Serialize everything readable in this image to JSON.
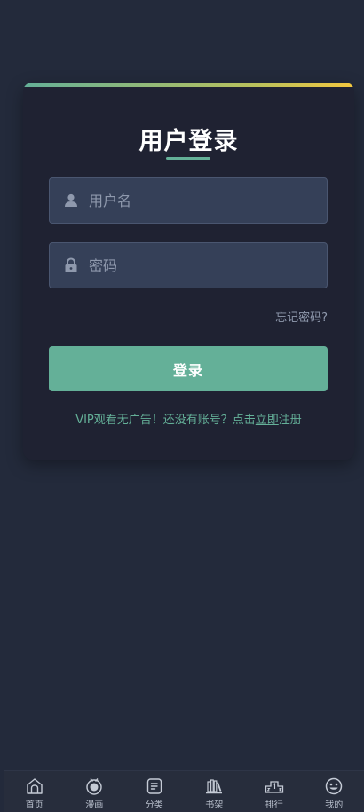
{
  "login_card": {
    "title": "用户登录",
    "username_placeholder": "用户名",
    "username_icon": "user-icon",
    "password_placeholder": "密码",
    "password_icon": "lock-icon",
    "forgot_password": "忘记密码?",
    "login_button": "登录",
    "register_prefix": "VIP观看无广告！还没有账号？",
    "register_link_pre": "点击",
    "register_link_underlined": "立即",
    "register_link_post": "注册"
  },
  "colors": {
    "accent": "#64b098",
    "background": "#232a3b",
    "card": "#1f2232",
    "input": "#354058"
  },
  "tabbar": {
    "items": [
      {
        "label": "首页",
        "icon": "home-icon"
      },
      {
        "label": "漫画",
        "icon": "comic-icon"
      },
      {
        "label": "分类",
        "icon": "category-icon"
      },
      {
        "label": "书架",
        "icon": "bookshelf-icon"
      },
      {
        "label": "排行",
        "icon": "ranking-icon"
      },
      {
        "label": "我的",
        "icon": "profile-icon"
      }
    ]
  }
}
